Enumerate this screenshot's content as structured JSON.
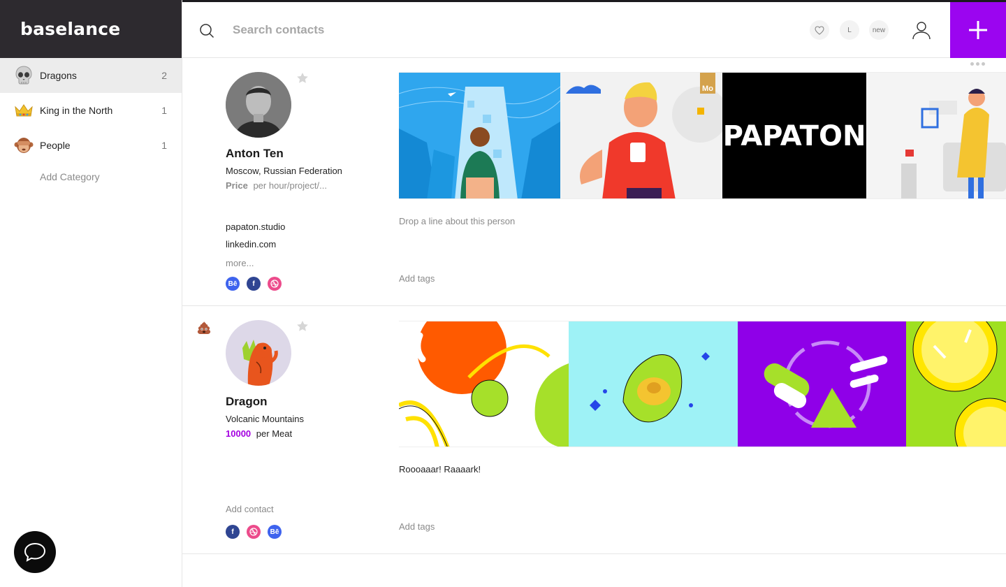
{
  "app": {
    "brand": "baselance"
  },
  "search": {
    "placeholder": "Search contacts"
  },
  "header": {
    "pill_l": "L",
    "pill_new": "new"
  },
  "sidebar": {
    "categories": [
      {
        "label": "Dragons",
        "count": "2",
        "icon": "skull-icon"
      },
      {
        "label": "King in the North",
        "count": "1",
        "icon": "crown-icon"
      },
      {
        "label": "People",
        "count": "1",
        "icon": "monkey-icon"
      }
    ],
    "add_category": "Add Category"
  },
  "contacts": [
    {
      "name": "Anton Ten",
      "location": "Moscow, Russian Federation",
      "price_label": "Price",
      "price_per": "per",
      "price_unit": "hour/project/...",
      "links": [
        "papaton.studio",
        "linkedin.com"
      ],
      "more": "more...",
      "note": "Drop a line about this person",
      "tags": "Add tags",
      "gallery_text": "PAPATON",
      "badge": "Mo",
      "socials": [
        "behance-icon",
        "facebook-icon",
        "dribbble-icon"
      ]
    },
    {
      "name": "Dragon",
      "location": "Volcanic Mountains",
      "price_amount": "10000",
      "price_per": "per",
      "price_unit": "Meat",
      "add_contact": "Add contact",
      "note": "Roooaaar! Raaaark!",
      "tags": "Add tags",
      "socials": [
        "facebook-icon",
        "dribbble-icon",
        "behance-icon"
      ]
    }
  ],
  "colors": {
    "accent": "#9b05f0",
    "sidebar_brand_bg": "#2d2a2f",
    "price_accent": "#a400e0"
  }
}
